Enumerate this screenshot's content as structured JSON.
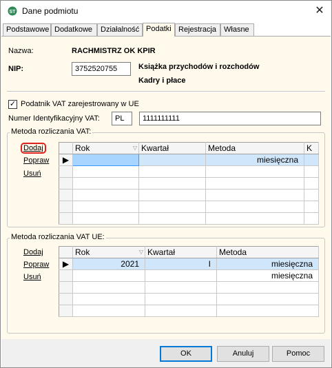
{
  "window": {
    "title": "Dane podmiotu"
  },
  "tabs": [
    {
      "label": "Podstawowe"
    },
    {
      "label": "Dodatkowe"
    },
    {
      "label": "Działalność"
    },
    {
      "label": "Podatki"
    },
    {
      "label": "Rejestracja"
    },
    {
      "label": "Własne"
    }
  ],
  "form": {
    "name_label": "Nazwa:",
    "name_value": "RACHMISTRZ OK KPIR",
    "nip_label": "NIP:",
    "nip_value": "3752520755",
    "book_label": "Książka przychodów i rozchodów",
    "hr_label": "Kadry i płace",
    "vat_ue_checkbox_label": "Podatnik VAT zarejestrowany w UE",
    "vat_ue_checked": true,
    "vat_id_label": "Numer Identyfikacyjny VAT:",
    "vat_country": "PL",
    "vat_number": "1111111111"
  },
  "vat_group": {
    "title": "Metoda rozliczania VAT:",
    "add_link": "Dodaj",
    "edit_link": "Popraw",
    "delete_link": "Usuń",
    "columns": [
      "Rok",
      "Kwartał",
      "Metoda",
      "K"
    ],
    "rows": [
      {
        "rok": "",
        "kwartal": "",
        "metoda": "miesięczna",
        "k": ""
      }
    ]
  },
  "vat_ue_group": {
    "title": "Metoda rozliczania VAT UE:",
    "add_link": "Dodaj",
    "edit_link": "Popraw",
    "delete_link": "Usuń",
    "columns": [
      "Rok",
      "Kwartał",
      "Metoda"
    ],
    "rows": [
      {
        "rok": "2021",
        "kwartal": "I",
        "metoda": "miesięczna"
      },
      {
        "rok": "",
        "kwartal": "",
        "metoda": "miesięczna"
      }
    ]
  },
  "buttons": {
    "ok": "OK",
    "cancel": "Anuluj",
    "help": "Pomoc"
  },
  "colors": {
    "panel_bg": "#fffaec",
    "selection": "#cfe6fb",
    "focus_cell": "#a8d5ff",
    "highlight_border": "#e0201c",
    "default_button_border": "#0078d7"
  }
}
